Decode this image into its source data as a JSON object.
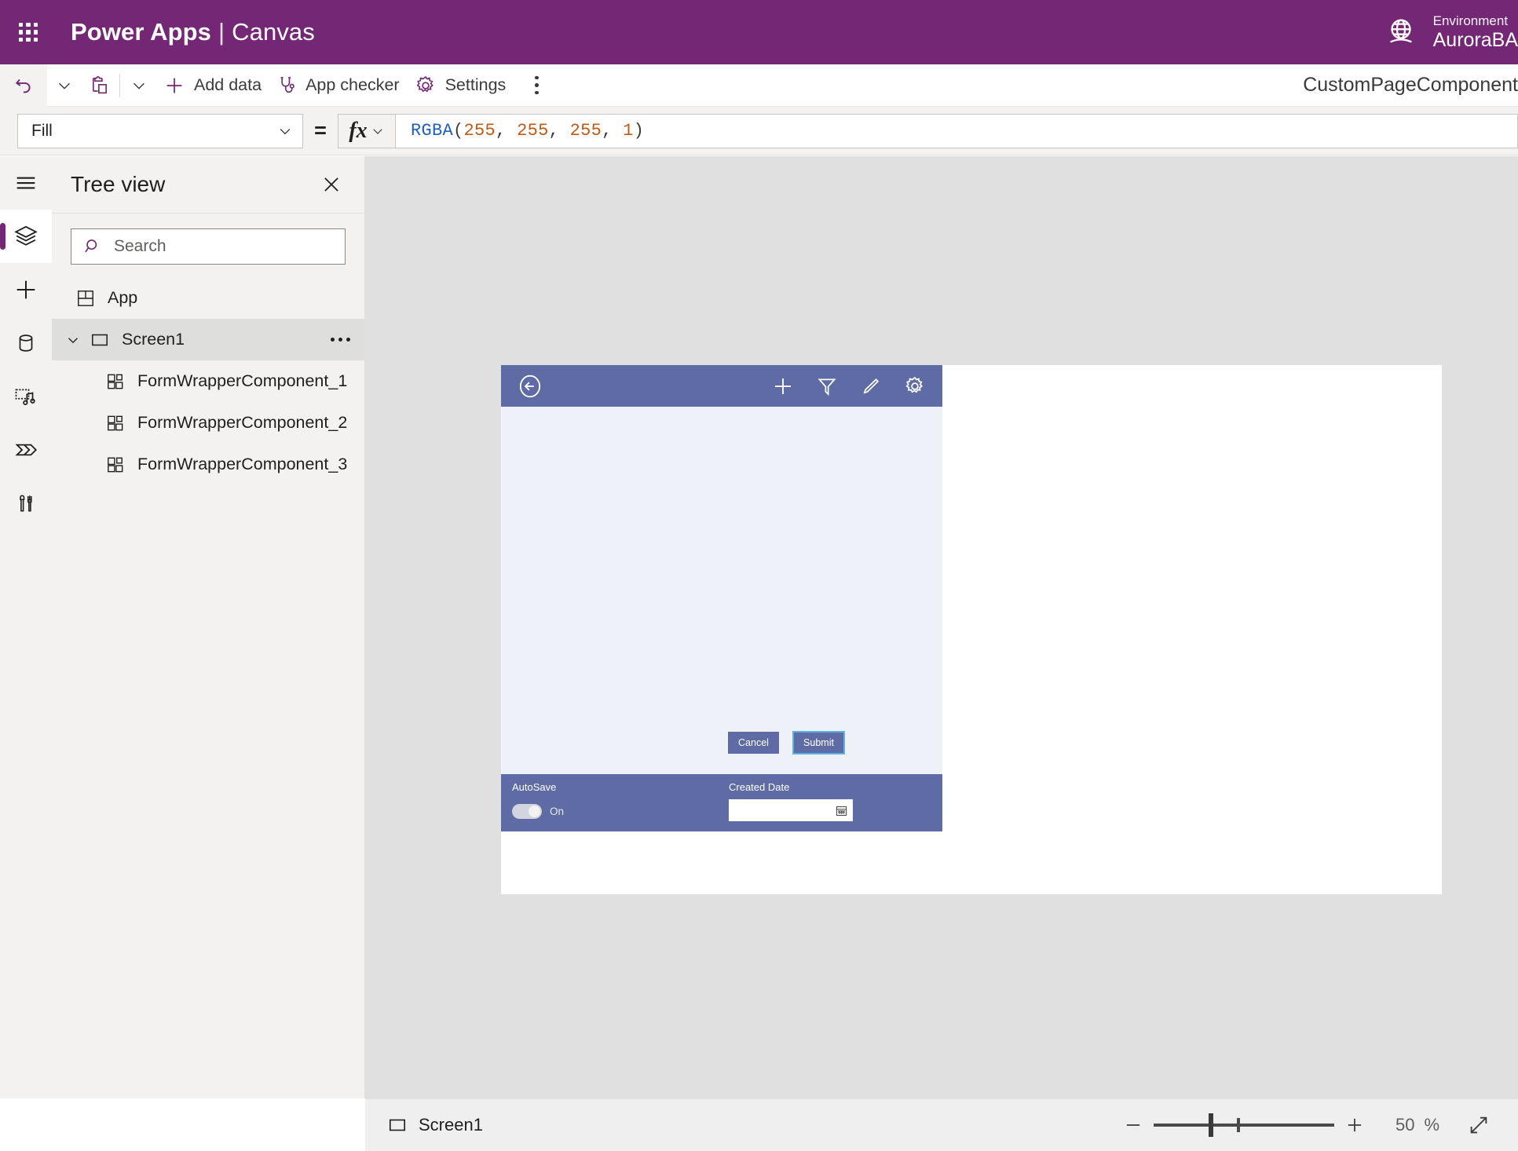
{
  "titlebar": {
    "waffle_icon": "app-launcher-icon",
    "product": "Power Apps",
    "separator": "|",
    "app_type": "Canvas",
    "environment_icon": "globe-environment-icon",
    "environment_label": "Environment",
    "environment_name": "AuroraBA"
  },
  "toolbar": {
    "undo_icon": "undo-icon",
    "undo_caret_icon": "chevron-down-icon",
    "paste_icon": "clipboard-paste-icon",
    "paste_caret_icon": "chevron-down-icon",
    "add_data_icon": "plus-icon",
    "add_data_label": "Add data",
    "app_checker_icon": "stethoscope-icon",
    "app_checker_label": "App checker",
    "settings_icon": "gear-icon",
    "settings_label": "Settings",
    "overflow_icon": "more-vertical-icon",
    "document_name": "CustomPageComponent"
  },
  "formula_bar": {
    "property": "Fill",
    "property_caret_icon": "chevron-down-icon",
    "equals": "=",
    "fx_glyph": "fx",
    "fx_caret_icon": "chevron-down-icon",
    "formula_tokens": [
      {
        "text": "RGBA",
        "kind": "fn"
      },
      {
        "text": "(",
        "kind": "punc"
      },
      {
        "text": "255",
        "kind": "num"
      },
      {
        "text": ", ",
        "kind": "punc"
      },
      {
        "text": "255",
        "kind": "num"
      },
      {
        "text": ", ",
        "kind": "punc"
      },
      {
        "text": "255",
        "kind": "num"
      },
      {
        "text": ", ",
        "kind": "punc"
      },
      {
        "text": "1",
        "kind": "num"
      },
      {
        "text": ")",
        "kind": "punc"
      }
    ],
    "formula_text": "RGBA(255, 255, 255, 1)"
  },
  "rail": {
    "items": [
      {
        "icon": "hamburger-menu-icon",
        "active": false
      },
      {
        "icon": "tree-view-layers-icon",
        "active": true
      },
      {
        "icon": "insert-plus-icon",
        "active": false
      },
      {
        "icon": "data-database-icon",
        "active": false
      },
      {
        "icon": "media-icon",
        "active": false
      },
      {
        "icon": "power-automate-icon",
        "active": false
      },
      {
        "icon": "variables-tools-icon",
        "active": false
      }
    ]
  },
  "tree_view": {
    "title": "Tree view",
    "close_icon": "close-icon",
    "search": {
      "icon": "search-icon",
      "placeholder": "Search",
      "value": ""
    },
    "nodes": [
      {
        "label": "App",
        "icon": "app-object-icon",
        "indent": 0,
        "selected": false,
        "has_chevron": false,
        "has_more": false
      },
      {
        "label": "Screen1",
        "icon": "screen-icon",
        "indent": 1,
        "selected": true,
        "has_chevron": true,
        "chevron_icon": "chevron-down-icon",
        "has_more": true,
        "more_icon": "more-horizontal-icon"
      },
      {
        "label": "FormWrapperComponent_1",
        "icon": "component-icon",
        "indent": 2,
        "selected": false,
        "has_chevron": false,
        "has_more": false
      },
      {
        "label": "FormWrapperComponent_2",
        "icon": "component-icon",
        "indent": 2,
        "selected": false,
        "has_chevron": false,
        "has_more": false
      },
      {
        "label": "FormWrapperComponent_3",
        "icon": "component-icon",
        "indent": 2,
        "selected": false,
        "has_chevron": false,
        "has_more": false
      }
    ]
  },
  "canvas": {
    "component": {
      "header": {
        "back_icon": "back-arrow-circle-icon",
        "actions": [
          {
            "icon": "plus-icon"
          },
          {
            "icon": "filter-icon"
          },
          {
            "icon": "edit-pencil-icon"
          },
          {
            "icon": "gear-icon"
          }
        ]
      },
      "buttons": [
        {
          "label": "Cancel",
          "selected": false
        },
        {
          "label": "Submit",
          "selected": true
        }
      ],
      "footer": {
        "autosave_label": "AutoSave",
        "autosave_state": "On",
        "created_date_label": "Created Date",
        "created_date_value": "",
        "calendar_icon": "calendar-icon"
      }
    }
  },
  "status_bar": {
    "screen_icon": "screen-icon",
    "screen_label": "Screen1",
    "zoom_out_icon": "minus-icon",
    "zoom_in_icon": "plus-icon",
    "zoom_value": "50",
    "zoom_unit": "%",
    "fit_screen_icon": "expand-diagonal-icon"
  },
  "colors": {
    "brand_purple": "#742774",
    "component_blue": "#5f6ba5",
    "component_body": "#eef2f8",
    "selection_blue": "#5bb3e4",
    "canvas_gray": "#e0e0e0",
    "panel_gray": "#f3f2f1"
  }
}
